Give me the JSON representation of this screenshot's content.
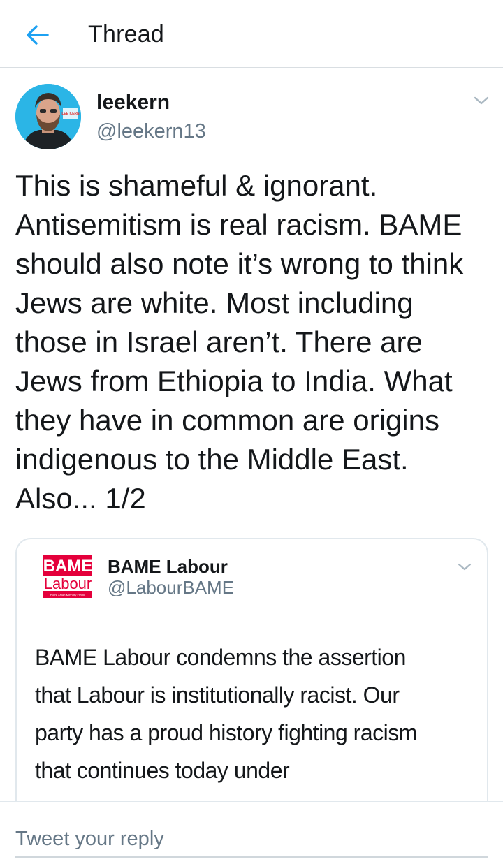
{
  "header": {
    "title": "Thread",
    "back_icon": "arrow-left-icon",
    "accent": "#1da1f2"
  },
  "tweet": {
    "author_name": "leekern",
    "author_handle": "@leekern13",
    "avatar_text": "LEE KERN",
    "text": "This is shameful & ignorant.\nAntisemitism is real racism. BAME\nshould also note it’s wrong to think\nJews are white. Most including\nthose in Israel aren’t. There are\nJews from Ethiopia to India. What\nthey have in common are origins\nindigenous to the Middle East.\nAlso... 1/2"
  },
  "quoted_tweet": {
    "author_name": "BAME Labour",
    "author_handle": "@LabourBAME",
    "logo_line1": "BAME",
    "logo_line2": "Labour",
    "logo_tagline": "Black Asian Minority Ethnic",
    "text": "BAME Labour condemns the assertion\nthat Labour is institutionally racist. Our\nparty has a proud history fighting racism\nthat continues today under"
  },
  "reply": {
    "placeholder": "Tweet your reply"
  }
}
